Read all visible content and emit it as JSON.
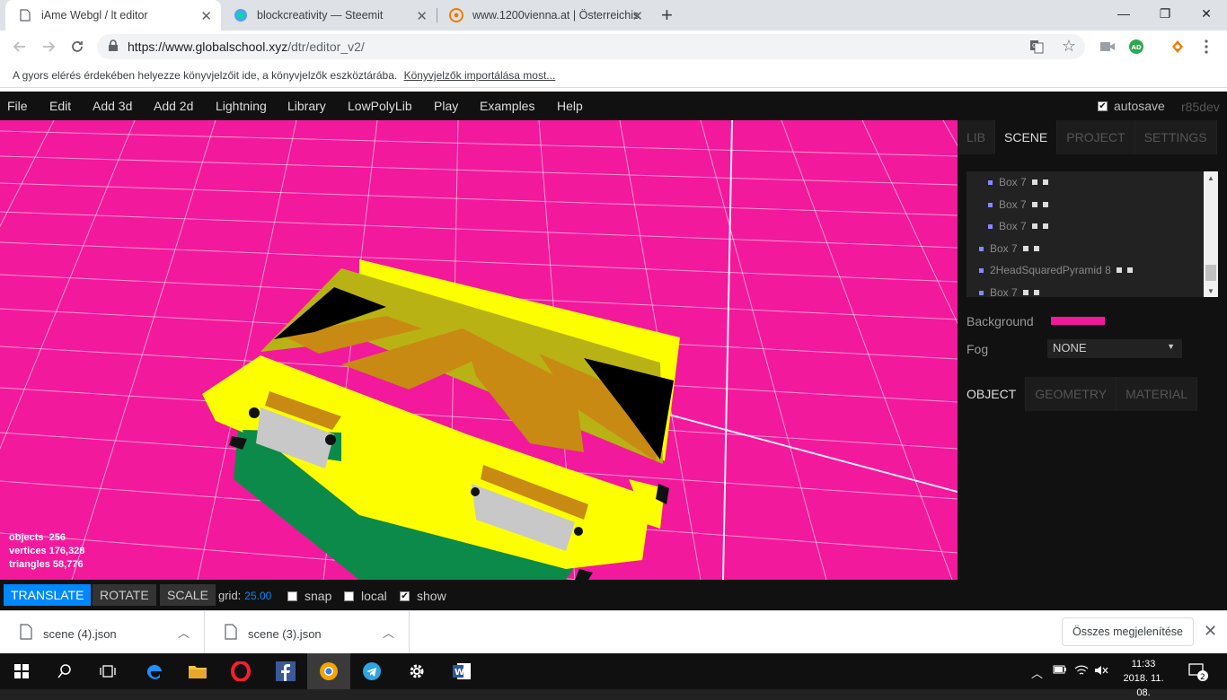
{
  "browser": {
    "tabs": [
      {
        "title": "iAme Webgl / lt editor",
        "icon": "document-icon"
      },
      {
        "title": "blockcreativity — Steemit",
        "icon": "steemit-icon"
      },
      {
        "title": "www.1200vienna.at | Österreichis",
        "icon": "avast-icon"
      }
    ],
    "close_glyph": "✕",
    "new_tab_glyph": "+",
    "window": {
      "minimize": "—",
      "maximize": "❐",
      "close": "✕"
    },
    "url_host": "https://www.globalschool.xyz",
    "url_path": "/dtr/editor_v2/",
    "bookmark_bar_text": "A gyors elérés érdekében helyezze könyvjelzőit ide, a könyvjelzők eszköztárába.",
    "bookmark_bar_link": "Könyvjelzők importálása most..."
  },
  "editor": {
    "menu": [
      "File",
      "Edit",
      "Add 3d",
      "Add 2d",
      "Lightning",
      "Library",
      "LowPolyLib",
      "Play",
      "Examples",
      "Help"
    ],
    "autosave_label": "autosave",
    "autosave_checked": true,
    "version": "r85dev",
    "stats": {
      "objects": "256",
      "vertices": "176,328",
      "triangles": "58,776"
    },
    "stats_labels": {
      "objects": "objects",
      "vertices": "vertices",
      "triangles": "triangles"
    },
    "transform_buttons": {
      "translate": "TRANSLATE",
      "rotate": "ROTATE",
      "scale": "SCALE"
    },
    "active_transform": "translate",
    "grid_label": "grid:",
    "grid_value": "25.00",
    "options": {
      "snap": "snap",
      "local": "local",
      "show": "show"
    },
    "options_checked": {
      "snap": false,
      "local": false,
      "show": true
    },
    "viewport_background": "#f2199c"
  },
  "sidebar": {
    "tabs": [
      "LIB",
      "SCENE",
      "PROJECT",
      "SETTINGS"
    ],
    "active_tab": "SCENE",
    "outliner": [
      {
        "label": "Box 7",
        "depth": 2
      },
      {
        "label": "Box 7",
        "depth": 2
      },
      {
        "label": "Box 7",
        "depth": 2
      },
      {
        "label": "Box 7",
        "depth": 1
      },
      {
        "label": "2HeadSquaredPyramid 8",
        "depth": 1
      },
      {
        "label": "Box 7",
        "depth": 1
      }
    ],
    "background_label": "Background",
    "background_color": "#f2199c",
    "fog_label": "Fog",
    "fog_value": "NONE",
    "object_tabs": [
      "OBJECT",
      "GEOMETRY",
      "MATERIAL"
    ],
    "active_object_tab": "OBJECT"
  },
  "downloads": {
    "items": [
      "scene (4).json",
      "scene (3).json"
    ],
    "show_all": "Összes megjelenítése"
  },
  "taskbar": {
    "time": "11:33",
    "date": "2018. 11. 08.",
    "notifications": "2"
  }
}
